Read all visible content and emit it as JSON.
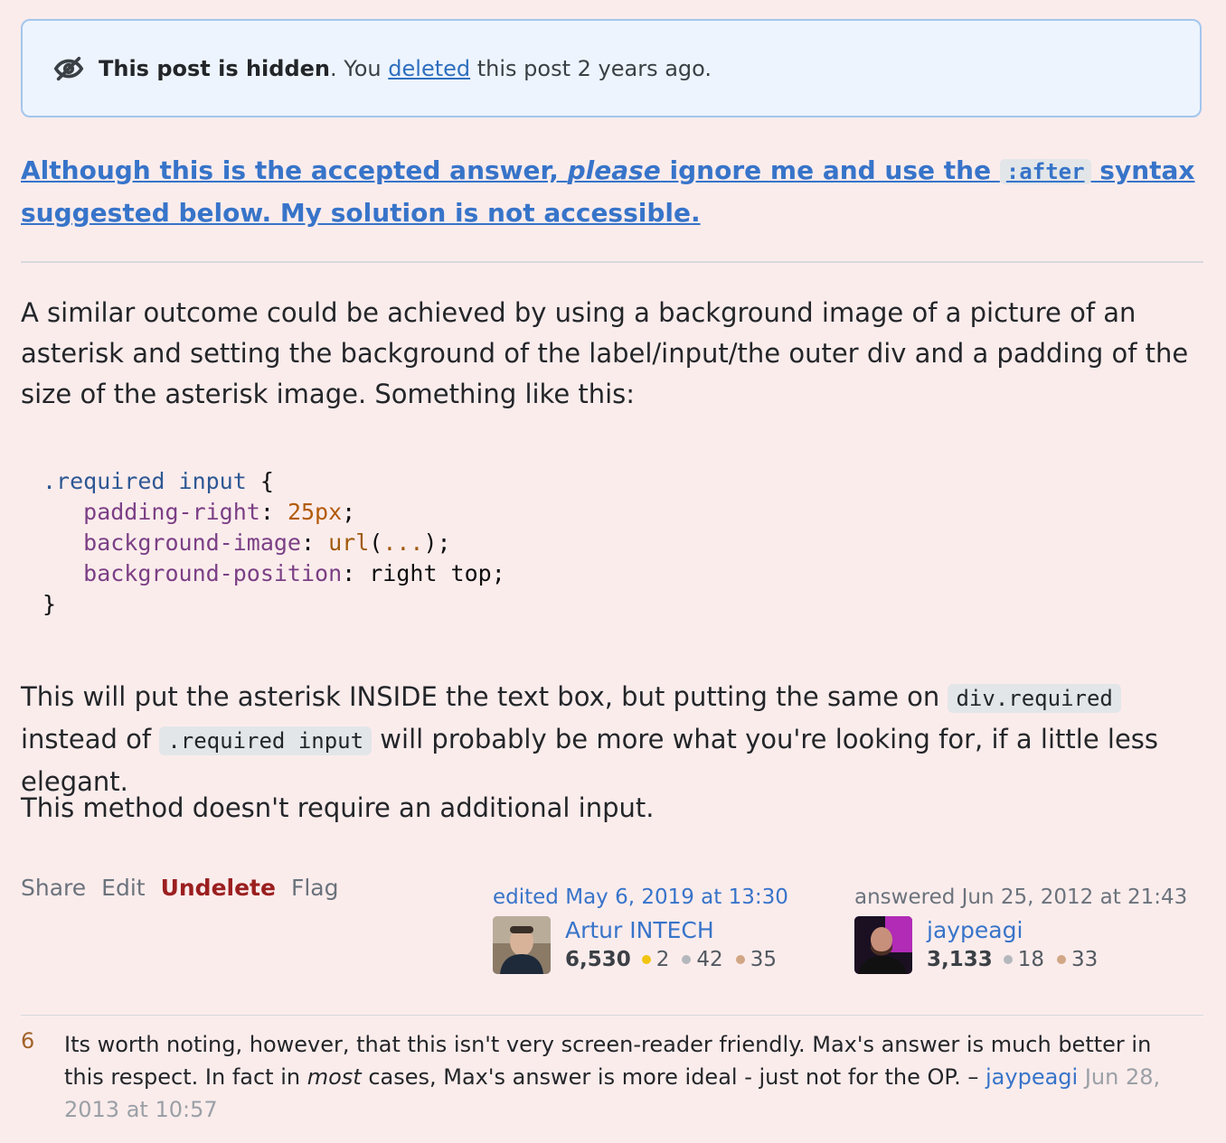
{
  "notice": {
    "bold": "This post is hidden",
    "pre": ". You ",
    "link": "deleted",
    "post": " this post 2 years ago."
  },
  "headline": {
    "part1": "Although this is the accepted answer, ",
    "emph": "please",
    "part2": " ignore me and use the ",
    "code": ":after",
    "part3": " syntax suggested below. My solution is not accessible."
  },
  "body": {
    "p1": "A similar outcome could be achieved by using a background image of a picture of an asterisk and setting the background of the label/input/the outer div and a padding of the size of the asterisk image. Something like this:",
    "p2_a": "This will put the asterisk INSIDE the text box, but putting the same on ",
    "p2_code1": "div.required",
    "p2_b": " instead of ",
    "p2_code2": ".required input",
    "p2_c": " will probably be more what you're looking for, if a little less elegant.",
    "p3": "This method doesn't require an additional input."
  },
  "code": {
    "selector": ".required input",
    "open": " {",
    "l1_prop": "padding-right",
    "l1_val": "25px",
    "l2_prop": "background-image",
    "l2_fn": "url",
    "l2_arg": "...",
    "l3_prop": "background-position",
    "l3_val": "right top",
    "close": "}"
  },
  "actions": {
    "share": "Share",
    "edit": "Edit",
    "undelete": "Undelete",
    "flag": "Flag"
  },
  "editor": {
    "when": "edited May 6, 2019 at 13:30",
    "name": "Artur INTECH",
    "rep": "6,530",
    "gold": "2",
    "silver": "42",
    "bronze": "35"
  },
  "author": {
    "when": "answered Jun 25, 2012 at 21:43",
    "name": "jaypeagi",
    "rep": "3,133",
    "silver": "18",
    "bronze": "33"
  },
  "comment": {
    "score": "6",
    "text_a": "Its worth noting, however, that this isn't very screen-reader friendly. Max's answer is much better in this respect. In fact in ",
    "emph": "most",
    "text_b": " cases, Max's answer is more ideal - just not for the OP. – ",
    "user": "jaypeagi",
    "date": " Jun 28, 2013 at 10:57"
  },
  "colors": {
    "background": "#fbecec",
    "link": "#3774c9",
    "undelete": "#9b1f1f",
    "notice_bg": "#edf4fd",
    "notice_border": "#a3c6ed"
  }
}
